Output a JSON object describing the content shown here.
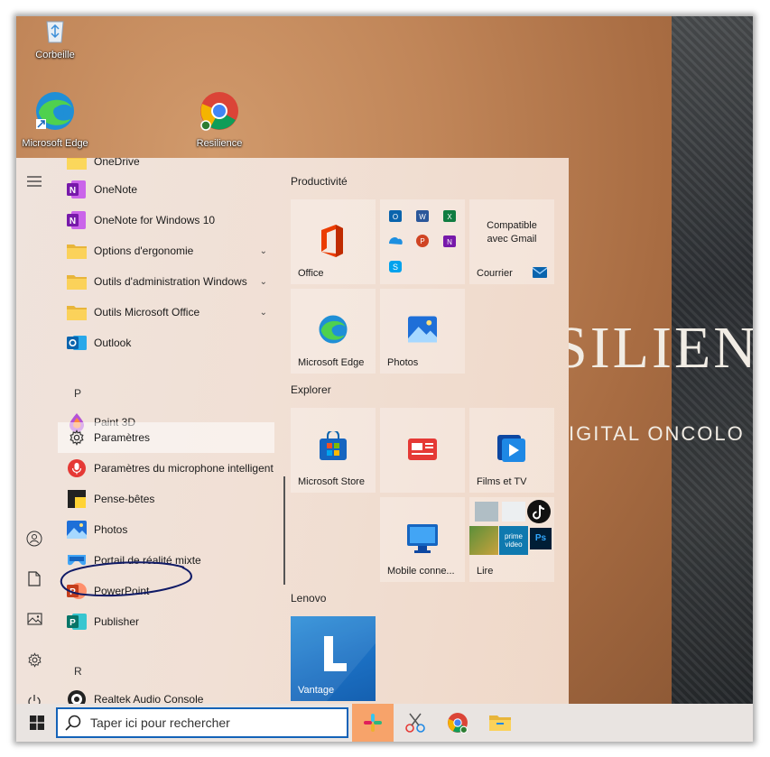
{
  "desktop": {
    "icons": [
      {
        "label": "Corbeille"
      },
      {
        "label": "Microsoft Edge"
      },
      {
        "label": "Resilience"
      }
    ],
    "wallpaper": {
      "brand_text": "SILIEN",
      "tagline": "IGITAL ONCOLO"
    }
  },
  "start_menu": {
    "apps": [
      {
        "label": "OneDrive"
      },
      {
        "label": "OneNote"
      },
      {
        "label": "OneNote for Windows 10"
      },
      {
        "label": "Options d'ergonomie"
      },
      {
        "label": "Outils d'administration Windows"
      },
      {
        "label": "Outils Microsoft Office"
      },
      {
        "label": "Outlook"
      },
      {
        "label": "P"
      },
      {
        "label": "Paint 3D"
      },
      {
        "label": "Paramètres"
      },
      {
        "label": "Paramètres du microphone intelligent"
      },
      {
        "label": "Pense-bêtes"
      },
      {
        "label": "Photos"
      },
      {
        "label": "Portail de réalité mixte"
      },
      {
        "label": "PowerPoint"
      },
      {
        "label": "Publisher"
      },
      {
        "label": "R"
      },
      {
        "label": "Realtek Audio Console"
      }
    ],
    "groups": [
      {
        "title": "Productivité"
      },
      {
        "title": "Explorer"
      },
      {
        "title": "Lenovo"
      }
    ],
    "tiles": {
      "office": "Office",
      "gmail_line1": "Compatible",
      "gmail_line2": "avec Gmail",
      "courrier": "Courrier",
      "edge": "Microsoft Edge",
      "photos": "Photos",
      "store": "Microsoft Store",
      "films": "Films et TV",
      "mobile": "Mobile conne...",
      "lire": "Lire",
      "vantage": "Vantage",
      "prime_line1": "prime",
      "prime_line2": "video"
    }
  },
  "taskbar": {
    "search_placeholder": "Taper ici pour rechercher"
  },
  "colors": {
    "accent": "#1463b8",
    "annotation_ink": "#0f1a66"
  }
}
